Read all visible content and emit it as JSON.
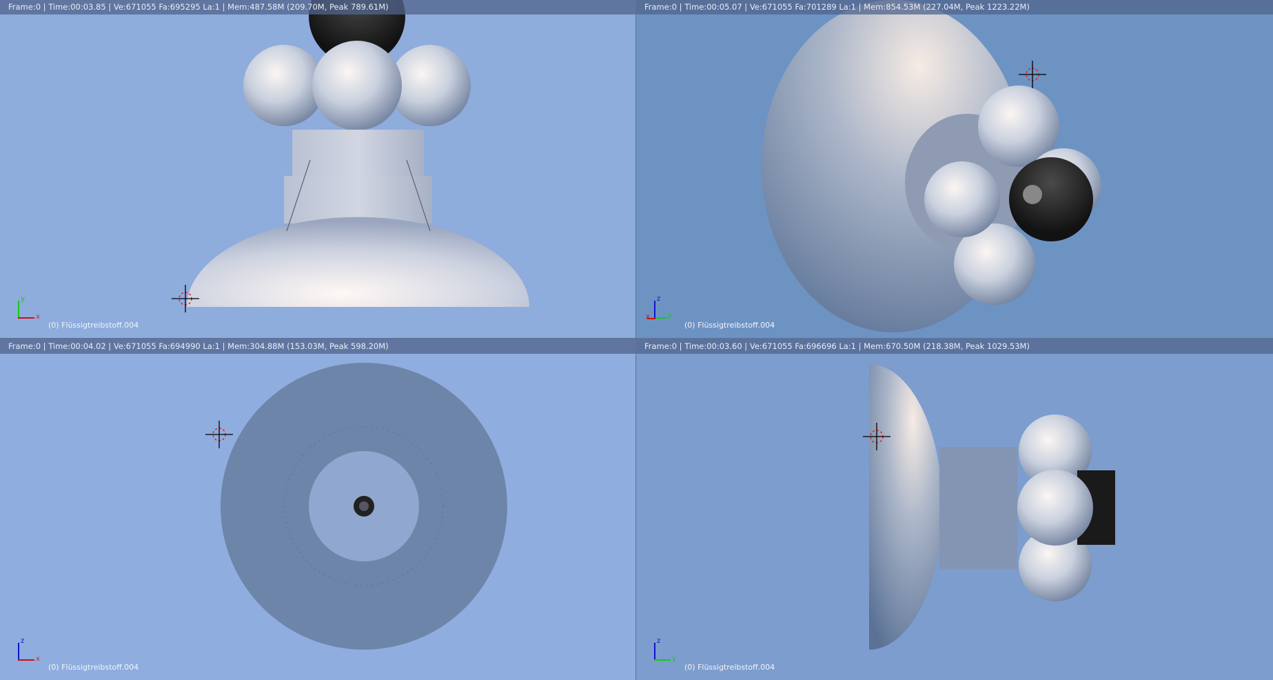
{
  "viewports": [
    {
      "header": "Frame:0 | Time:00:03.85 | Ve:671055 Fa:695295 La:1 | Mem:487.58M (209.70M, Peak 789.61M)",
      "object_label": "(0) Flüssigtreibstoff.004",
      "axis_v": "y",
      "axis_h": "x",
      "bg": "#8eacdc"
    },
    {
      "header": "Frame:0 | Time:00:05.07 | Ve:671055 Fa:701289 La:1 | Mem:854.53M (227.04M, Peak 1223.22M)",
      "object_label": "(0) Flüssigtreibstoff.004",
      "axis_v": "z",
      "axis_h": "x",
      "axis_h2": "y",
      "bg": "#6d93c3"
    },
    {
      "header": "Frame:0 | Time:00:04.02 | Ve:671055 Fa:694990 La:1 | Mem:304.88M (153.03M, Peak 598.20M)",
      "object_label": "(0) Flüssigtreibstoff.004",
      "axis_v": "z",
      "axis_h": "x",
      "bg": "#8fadde"
    },
    {
      "header": "Frame:0 | Time:00:03.60 | Ve:671055 Fa:696696 La:1 | Mem:670.50M (218.38M, Peak 1029.53M)",
      "object_label": "(0) Flüssigtreibstoff.004",
      "axis_v": "z",
      "axis_h": "y",
      "bg": "#7c9dcd"
    }
  ]
}
